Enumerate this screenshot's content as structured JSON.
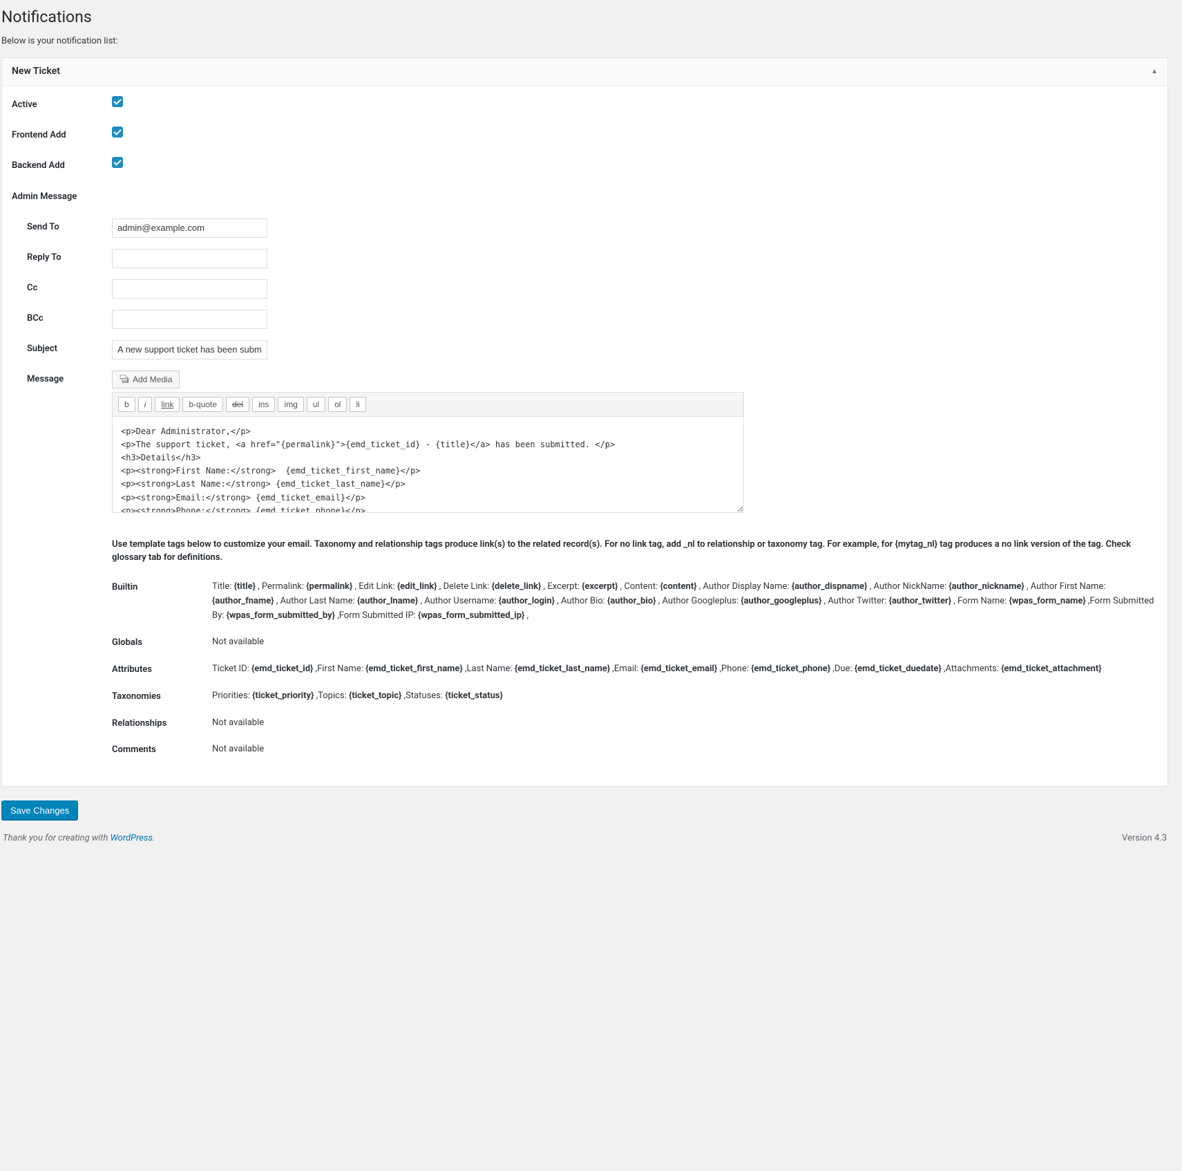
{
  "page": {
    "title": "Notifications",
    "subtitle": "Below is your notification list:"
  },
  "panel": {
    "title": "New Ticket"
  },
  "labels": {
    "active": "Active",
    "frontend_add": "Frontend Add",
    "backend_add": "Backend Add",
    "admin_message": "Admin Message",
    "send_to": "Send To",
    "reply_to": "Reply To",
    "cc": "Cc",
    "bcc": "BCc",
    "subject": "Subject",
    "message": "Message",
    "add_media": "Add Media"
  },
  "values": {
    "active": true,
    "frontend_add": true,
    "backend_add": true,
    "send_to": "admin@example.com",
    "reply_to": "",
    "cc": "",
    "bcc": "",
    "subject": "A new support ticket has been submitted",
    "message": "<p>Dear Administrator,</p>\n<p>The support ticket, <a href=\"{permalink}\">{emd_ticket_id} - {title}</a> has been submitted. </p>\n<h3>Details</h3>\n<p><strong>First Name:</strong>  {emd_ticket_first_name}</p>\n<p><strong>Last Name:</strong> {emd_ticket_last_name}</p>\n<p><strong>Email:</strong> {emd_ticket_email}</p>\n<p><strong>Phone:</strong> {emd_ticket_phone}</p>\n<p><strong>Content:</strong> {content}</p>"
  },
  "toolbar": {
    "b": "b",
    "i": "i",
    "link": "link",
    "bquote": "b-quote",
    "del": "del",
    "ins": "ins",
    "img": "img",
    "ul": "ul",
    "ol": "ol",
    "li": "li"
  },
  "help": "Use template tags below to customize your email. Taxonomy and relationship tags produce link(s) to the related record(s). For no link tag, add _nl to relationship or taxonomy tag. For example, for {mytag_nl} tag produces a no link version of the tag. Check glossary tab for definitions.",
  "tags": {
    "builtin_label": "Builtin",
    "builtin_html": "Title: <b>{title}</b> , Permalink: <b>{permalink}</b> , Edit Link: <b>{edit_link}</b> , Delete Link: <b>{delete_link}</b> , Excerpt: <b>{excerpt}</b> , Content: <b>{content}</b> , Author Display Name: <b>{author_dispname}</b> , Author NickName: <b>{author_nickname}</b> , Author First Name: <b>{author_fname}</b> , Author Last Name: <b>{author_lname}</b> , Author Username: <b>{author_login}</b> , Author Bio: <b>{author_bio}</b> , Author Googleplus: <b>{author_googleplus}</b> , Author Twitter: <b>{author_twitter}</b> , Form Name: <b>{wpas_form_name}</b> ,Form Submitted By: <b>{wpas_form_submitted_by}</b> ,Form Submitted IP: <b>{wpas_form_submitted_ip}</b> ,",
    "globals_label": "Globals",
    "globals_text": "Not available",
    "attributes_label": "Attributes",
    "attributes_html": "Ticket ID: <b>{emd_ticket_id}</b> ,First Name: <b>{emd_ticket_first_name}</b> ,Last Name: <b>{emd_ticket_last_name}</b> ,Email: <b>{emd_ticket_email}</b> ,Phone: <b>{emd_ticket_phone}</b> ,Due: <b>{emd_ticket_duedate}</b> ,Attachments: <b>{emd_ticket_attachment}</b>",
    "taxonomies_label": "Taxonomies",
    "taxonomies_html": "Priorities: <b>{ticket_priority}</b> ,Topics: <b>{ticket_topic}</b> ,Statuses: <b>{ticket_status}</b>",
    "relationships_label": "Relationships",
    "relationships_text": "Not available",
    "comments_label": "Comments",
    "comments_text": "Not available"
  },
  "save_label": "Save Changes",
  "footer": {
    "thanks_prefix": "Thank you for creating with ",
    "link_text": "WordPress",
    "suffix": ".",
    "version": "Version 4.3"
  }
}
